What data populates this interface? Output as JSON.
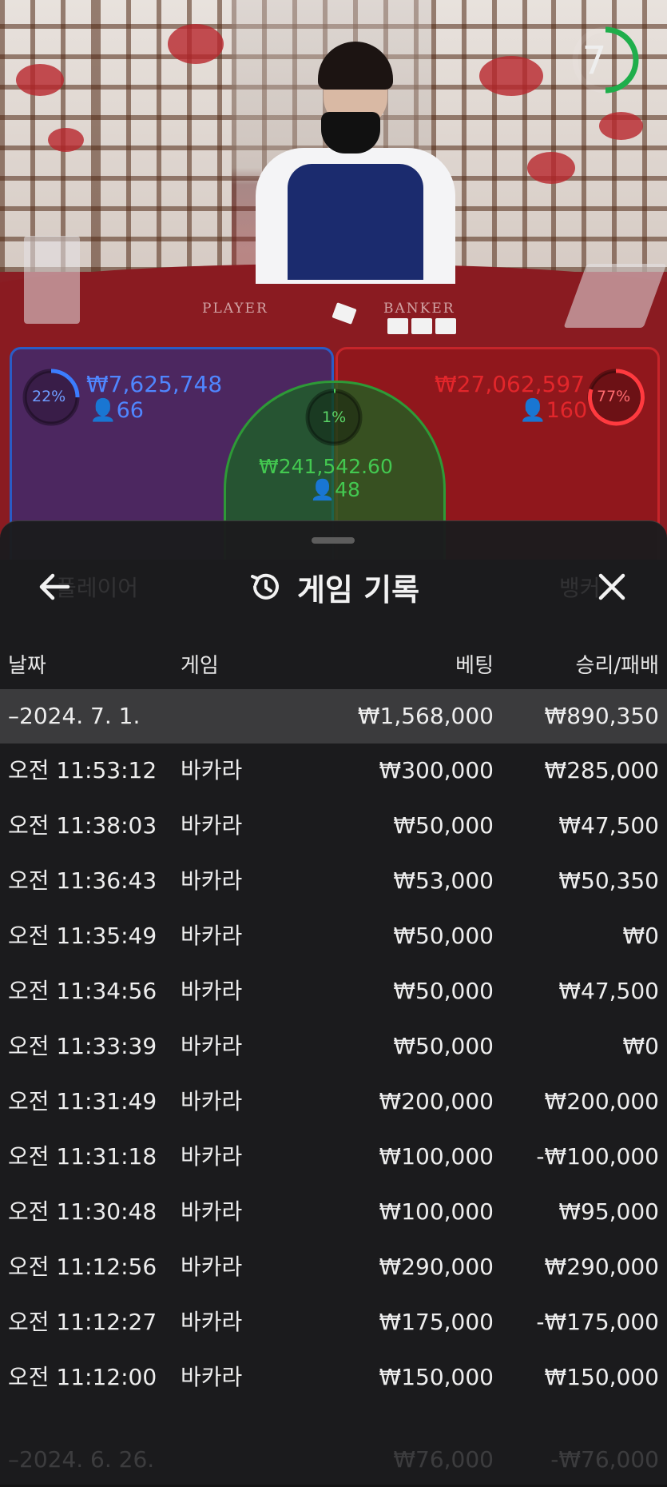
{
  "video": {
    "timer": "7",
    "table_label_player": "PLAYER",
    "table_label_banker": "BANKER",
    "player": {
      "percent": "22%",
      "percent_value": 22,
      "amount": "₩7,625,748",
      "bettors": "66"
    },
    "tie": {
      "percent": "1%",
      "percent_value": 1,
      "amount": "₩241,542.60",
      "bettors": "48"
    },
    "banker": {
      "percent": "77%",
      "percent_value": 77,
      "amount": "₩27,062,597",
      "bettors": "160"
    },
    "colors": {
      "player": "#2a5cc6",
      "banker": "#c6252a",
      "tie": "#2e9a37",
      "timer": "#1fae4b"
    }
  },
  "sheet": {
    "title": "게임 기록",
    "title_icon": "history-icon",
    "back_icon": "arrow-left-icon",
    "close_icon": "close-icon",
    "background_hints": {
      "left": "플레이어",
      "right": "뱅커"
    },
    "columns": {
      "date": "날짜",
      "game": "게임",
      "bet": "베팅",
      "result": "승리/패배"
    },
    "date_group": {
      "date": "–2024. 7. 1.",
      "bet": "₩1,568,000",
      "result": "₩890,350"
    },
    "rows": [
      {
        "time": "오전 11:53:12",
        "game": "바카라",
        "bet": "₩300,000",
        "result": "₩285,000"
      },
      {
        "time": "오전 11:38:03",
        "game": "바카라",
        "bet": "₩50,000",
        "result": "₩47,500"
      },
      {
        "time": "오전 11:36:43",
        "game": "바카라",
        "bet": "₩53,000",
        "result": "₩50,350"
      },
      {
        "time": "오전 11:35:49",
        "game": "바카라",
        "bet": "₩50,000",
        "result": "₩0"
      },
      {
        "time": "오전 11:34:56",
        "game": "바카라",
        "bet": "₩50,000",
        "result": "₩47,500"
      },
      {
        "time": "오전 11:33:39",
        "game": "바카라",
        "bet": "₩50,000",
        "result": "₩0"
      },
      {
        "time": "오전 11:31:49",
        "game": "바카라",
        "bet": "₩200,000",
        "result": "₩200,000"
      },
      {
        "time": "오전 11:31:18",
        "game": "바카라",
        "bet": "₩100,000",
        "result": "-₩100,000"
      },
      {
        "time": "오전 11:30:48",
        "game": "바카라",
        "bet": "₩100,000",
        "result": "₩95,000"
      },
      {
        "time": "오전 11:12:56",
        "game": "바카라",
        "bet": "₩290,000",
        "result": "₩290,000"
      },
      {
        "time": "오전 11:12:27",
        "game": "바카라",
        "bet": "₩175,000",
        "result": "-₩175,000"
      },
      {
        "time": "오전 11:12:00",
        "game": "바카라",
        "bet": "₩150,000",
        "result": "₩150,000"
      }
    ],
    "next_date_group": {
      "date": "–2024. 6. 26.",
      "bet": "₩76,000",
      "result": "-₩76,000"
    }
  }
}
